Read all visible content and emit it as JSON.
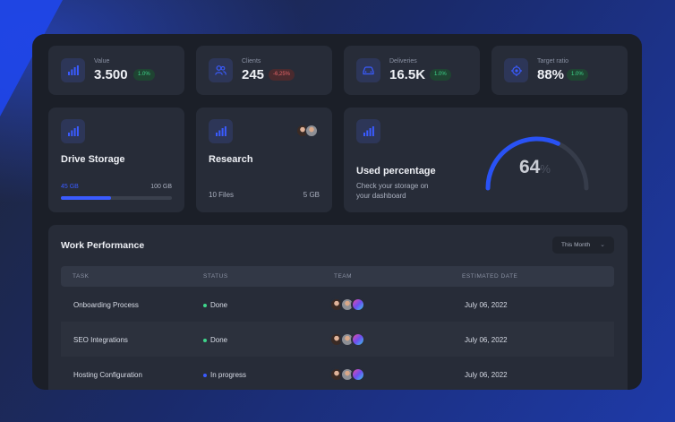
{
  "colors": {
    "accent": "#2952f5",
    "positive": "#3ed68b",
    "negative": "#e56468",
    "progress": "#3a5bff"
  },
  "stats": [
    {
      "label": "Value",
      "value": "3.500",
      "change": "1.0%",
      "trend": "positive",
      "icon": "bar-chart-icon"
    },
    {
      "label": "Clients",
      "value": "245",
      "change": "-6,25%",
      "trend": "negative",
      "icon": "users-icon"
    },
    {
      "label": "Deliveries",
      "value": "16.5K",
      "change": "1.0%",
      "trend": "positive",
      "icon": "car-icon"
    },
    {
      "label": "Target ratio",
      "value": "88%",
      "change": "1.0%",
      "trend": "positive",
      "icon": "target-icon"
    }
  ],
  "drive": {
    "title": "Drive Storage",
    "used": "45 GB",
    "total": "100 GB",
    "progress": 0.45
  },
  "research": {
    "title": "Research",
    "files": "10 Files",
    "size": "5 GB"
  },
  "used_percentage": {
    "title": "Used percentage",
    "subtitle_line1": "Check your storage on",
    "subtitle_line2": "your dashboard",
    "value": "64",
    "unit": "%",
    "fraction": 0.64
  },
  "work": {
    "title": "Work Performance",
    "filter": "This Month",
    "columns": [
      "TASK",
      "STATUS",
      "TEAM",
      "ESTIMATED DATE"
    ],
    "rows": [
      {
        "task": "Onboarding Process",
        "status": "Done",
        "status_color": "#3ed68b",
        "date": "July 06, 2022"
      },
      {
        "task": "SEO Integrations",
        "status": "Done",
        "status_color": "#3ed68b",
        "date": "July 06, 2022"
      },
      {
        "task": "Hosting Configuration",
        "status": "In progress",
        "status_color": "#3a5bff",
        "date": "July 06, 2022"
      }
    ]
  }
}
